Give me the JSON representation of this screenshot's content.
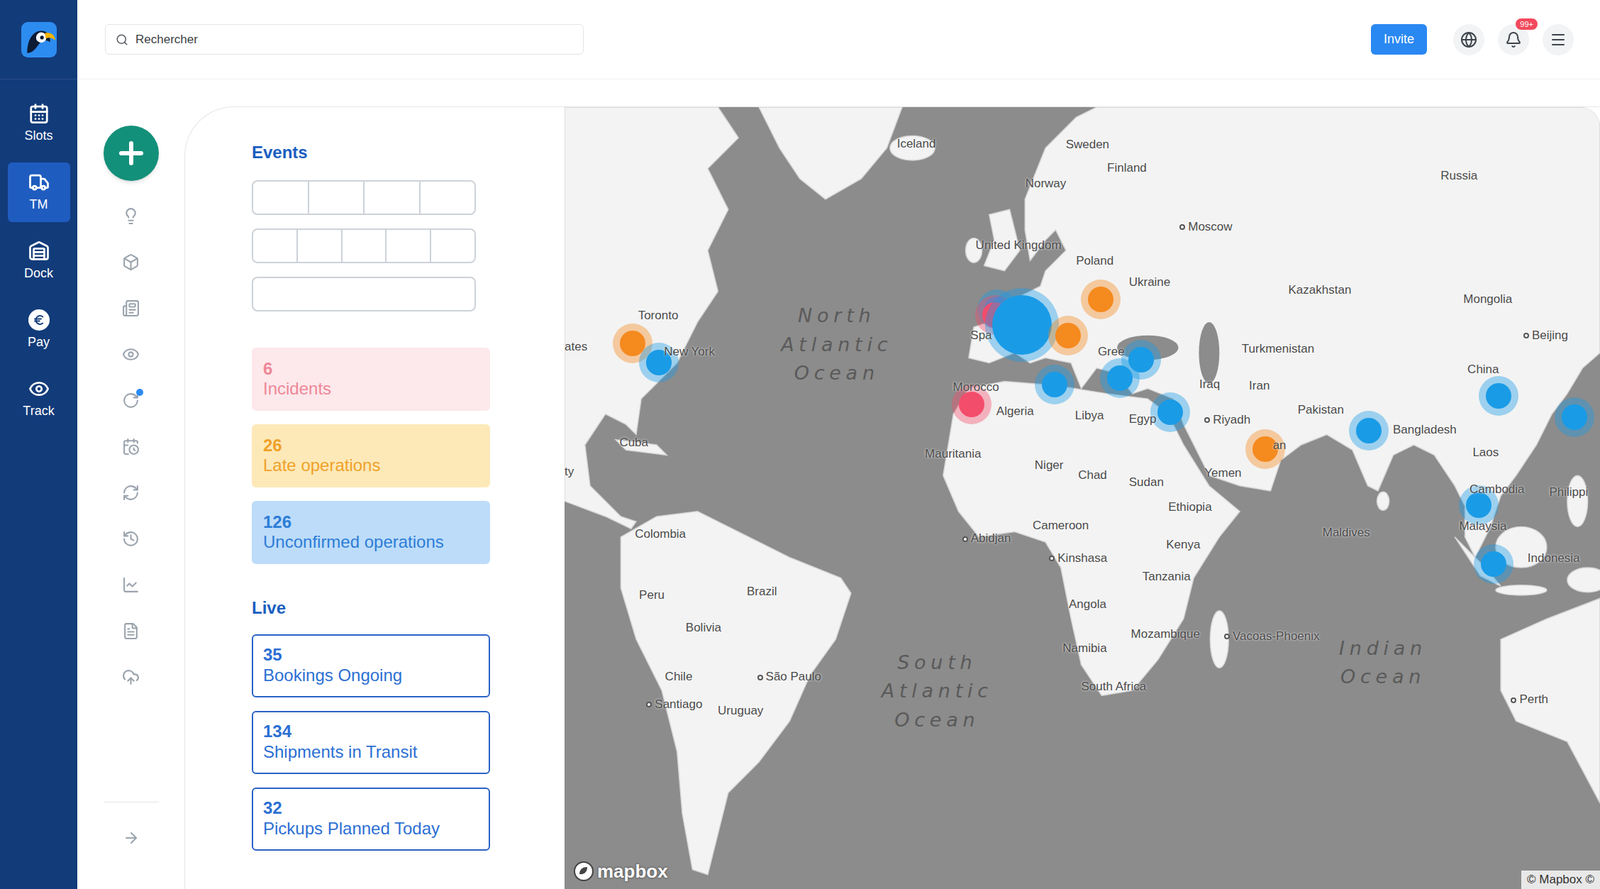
{
  "topbar": {
    "search": {
      "placeholder": "Rechercher"
    },
    "invite": "Invite",
    "notifications": {
      "badge": "99+"
    }
  },
  "nav": [
    {
      "label": "Slots",
      "selected": false
    },
    {
      "label": "TM",
      "selected": true
    },
    {
      "label": "Dock",
      "selected": false
    },
    {
      "label": "Pay",
      "selected": false
    },
    {
      "label": "Track",
      "selected": false
    }
  ],
  "rail": [
    {
      "dot": false
    },
    {
      "dot": false
    },
    {
      "dot": false
    },
    {
      "dot": false
    },
    {
      "dot": true
    },
    {
      "dot": false
    },
    {
      "dot": false
    },
    {
      "dot": false
    },
    {
      "dot": false
    },
    {
      "dot": false
    },
    {
      "dot": false
    }
  ],
  "events": {
    "title": "Events",
    "skeleton_fields": [
      {
        "segments": 4
      },
      {
        "segments": 5
      },
      {
        "segments": 1
      }
    ],
    "cards": [
      {
        "count": "6",
        "label": "Incidents",
        "color": "#ee8797",
        "background": "#fde8eb"
      },
      {
        "count": "26",
        "label": "Late operations",
        "color": "#f0a128",
        "background": "#fde9b8"
      },
      {
        "count": "126",
        "label": "Unconfirmed operations",
        "color": "#2c7dd6",
        "background": "#bddcfa"
      }
    ]
  },
  "live": {
    "title": "Live",
    "cards": [
      {
        "count": "35",
        "label": "Bookings Ongoing"
      },
      {
        "count": "134",
        "label": "Shipments in Transit"
      },
      {
        "count": "32",
        "label": "Pickups Planned Today"
      }
    ]
  },
  "map": {
    "labels": [
      {
        "text": "Iceland",
        "kind": "country"
      },
      {
        "text": "Sweden",
        "kind": "country"
      },
      {
        "text": "Finland",
        "kind": "country"
      },
      {
        "text": "Norway",
        "kind": "country"
      },
      {
        "text": "Russia",
        "kind": "country"
      },
      {
        "text": "Moscow",
        "kind": "city"
      },
      {
        "text": "United Kingdom",
        "kind": "country"
      },
      {
        "text": "Poland",
        "kind": "country"
      },
      {
        "text": "Ukraine",
        "kind": "country"
      },
      {
        "text": "Kazakhstan",
        "kind": "country"
      },
      {
        "text": "Mongolia",
        "kind": "country"
      },
      {
        "text": "Beijing",
        "kind": "city"
      },
      {
        "text": "Toronto",
        "kind": "country"
      },
      {
        "text": "New York",
        "kind": "country"
      },
      {
        "text": "ates",
        "kind": "country"
      },
      {
        "text": "North Atlantic Ocean",
        "kind": "ocean"
      },
      {
        "text": "Spa",
        "kind": "country"
      },
      {
        "text": "Gree",
        "kind": "country"
      },
      {
        "text": "Turkmenistan",
        "kind": "country"
      },
      {
        "text": "Iraq",
        "kind": "country"
      },
      {
        "text": "Iran",
        "kind": "country"
      },
      {
        "text": "Morocco",
        "kind": "country"
      },
      {
        "text": "Algeria",
        "kind": "country"
      },
      {
        "text": "Libya",
        "kind": "country"
      },
      {
        "text": "Egyp",
        "kind": "country"
      },
      {
        "text": "China",
        "kind": "country"
      },
      {
        "text": "Pakistan",
        "kind": "country"
      },
      {
        "text": "Riyadh",
        "kind": "city"
      },
      {
        "text": "Bangladesh",
        "kind": "country"
      },
      {
        "text": "Laos",
        "kind": "country"
      },
      {
        "text": "Cuba",
        "kind": "country"
      },
      {
        "text": "ty",
        "kind": "country"
      },
      {
        "text": "Mauritania",
        "kind": "country"
      },
      {
        "text": "Niger",
        "kind": "country"
      },
      {
        "text": "Chad",
        "kind": "country"
      },
      {
        "text": "Sudan",
        "kind": "country"
      },
      {
        "text": "Yemen",
        "kind": "country"
      },
      {
        "text": "an",
        "kind": "country"
      },
      {
        "text": "Cambodia",
        "kind": "country"
      },
      {
        "text": "Philippi",
        "kind": "country"
      },
      {
        "text": "Malaysia",
        "kind": "country"
      },
      {
        "text": "Ethiopia",
        "kind": "country"
      },
      {
        "text": "Maldives",
        "kind": "country"
      },
      {
        "text": "Colombia",
        "kind": "country"
      },
      {
        "text": "Cameroon",
        "kind": "country"
      },
      {
        "text": "Abidjan",
        "kind": "city"
      },
      {
        "text": "Kenya",
        "kind": "country"
      },
      {
        "text": "Indonesia",
        "kind": "country"
      },
      {
        "text": "Kinshasa",
        "kind": "city"
      },
      {
        "text": "Tanzania",
        "kind": "country"
      },
      {
        "text": "Peru",
        "kind": "country"
      },
      {
        "text": "Brazil",
        "kind": "country"
      },
      {
        "text": "Angola",
        "kind": "country"
      },
      {
        "text": "Bolivia",
        "kind": "country"
      },
      {
        "text": "Mozambique",
        "kind": "country"
      },
      {
        "text": "Vacoas-Phoenix",
        "kind": "city"
      },
      {
        "text": "Namibia",
        "kind": "country"
      },
      {
        "text": "Chile",
        "kind": "country"
      },
      {
        "text": "São Paulo",
        "kind": "city"
      },
      {
        "text": "Indian Ocean",
        "kind": "ocean"
      },
      {
        "text": "South Atlantic Ocean",
        "kind": "ocean"
      },
      {
        "text": "Santiago",
        "kind": "city"
      },
      {
        "text": "Uruguay",
        "kind": "country"
      },
      {
        "text": "South Africa",
        "kind": "country"
      },
      {
        "text": "Perth",
        "kind": "city"
      }
    ],
    "markers": [
      {
        "color": "#f58a1f",
        "kind": "pin"
      },
      {
        "color": "#1a9be6",
        "kind": "pin"
      },
      {
        "color": "#1a9be6",
        "kind": "pin"
      },
      {
        "color": "#f24d6b",
        "kind": "pin"
      },
      {
        "color": "#1a9be6",
        "kind": "cluster"
      },
      {
        "color": "#f58a1f",
        "kind": "pin"
      },
      {
        "color": "#f58a1f",
        "kind": "pin"
      },
      {
        "color": "#1a9be6",
        "kind": "pin"
      },
      {
        "color": "#1a9be6",
        "kind": "pin"
      },
      {
        "color": "#1a9be6",
        "kind": "pin"
      },
      {
        "color": "#f24d6b",
        "kind": "pin"
      },
      {
        "color": "#1a9be6",
        "kind": "pin"
      },
      {
        "color": "#f58a1f",
        "kind": "pin"
      },
      {
        "color": "#1a9be6",
        "kind": "pin"
      },
      {
        "color": "#1a9be6",
        "kind": "pin"
      },
      {
        "color": "#1a9be6",
        "kind": "pin"
      },
      {
        "color": "#1a9be6",
        "kind": "pin"
      },
      {
        "color": "#1a9be6",
        "kind": "pin"
      }
    ],
    "attribution": {
      "logo": "mapbox",
      "credit": "© Mapbox ©"
    }
  }
}
